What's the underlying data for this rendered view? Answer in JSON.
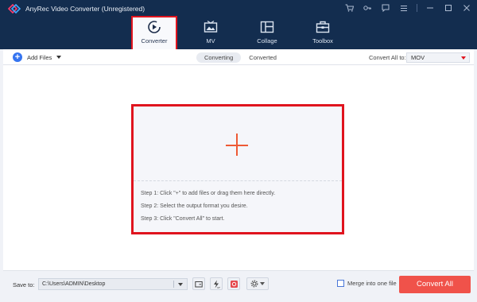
{
  "app": {
    "title": "AnyRec Video Converter (Unregistered)"
  },
  "window_controls": [
    "cart-icon",
    "key-icon",
    "feedback-icon",
    "menu-icon",
    "minimize-icon",
    "maximize-icon",
    "close-icon"
  ],
  "tabs": [
    {
      "label": "Converter",
      "icon": "converter-icon",
      "active": true
    },
    {
      "label": "MV",
      "icon": "mv-icon",
      "active": false
    },
    {
      "label": "Collage",
      "icon": "collage-icon",
      "active": false
    },
    {
      "label": "Toolbox",
      "icon": "toolbox-icon",
      "active": false
    }
  ],
  "toolbar": {
    "add_files_label": "Add Files",
    "segments": [
      "Converting",
      "Converted"
    ],
    "active_segment": "Converting",
    "convert_all_to_label": "Convert All to:",
    "format_value": "MOV"
  },
  "dropzone": {
    "steps": [
      "Step 1: Click \"+\" to add files or drag them here directly.",
      "Step 2: Select the output format you desire.",
      "Step 3: Click \"Convert All\" to start."
    ]
  },
  "footer": {
    "save_to_label": "Save to:",
    "save_path": "C:\\Users\\ADMIN\\Desktop",
    "merge_label": "Merge into one file",
    "merge_checked": false,
    "convert_button": "Convert All"
  },
  "colors": {
    "header_bg": "#132d4f",
    "highlight_border": "#e0141e",
    "accent_blue": "#3574f0",
    "convert_button": "#f0524a"
  }
}
